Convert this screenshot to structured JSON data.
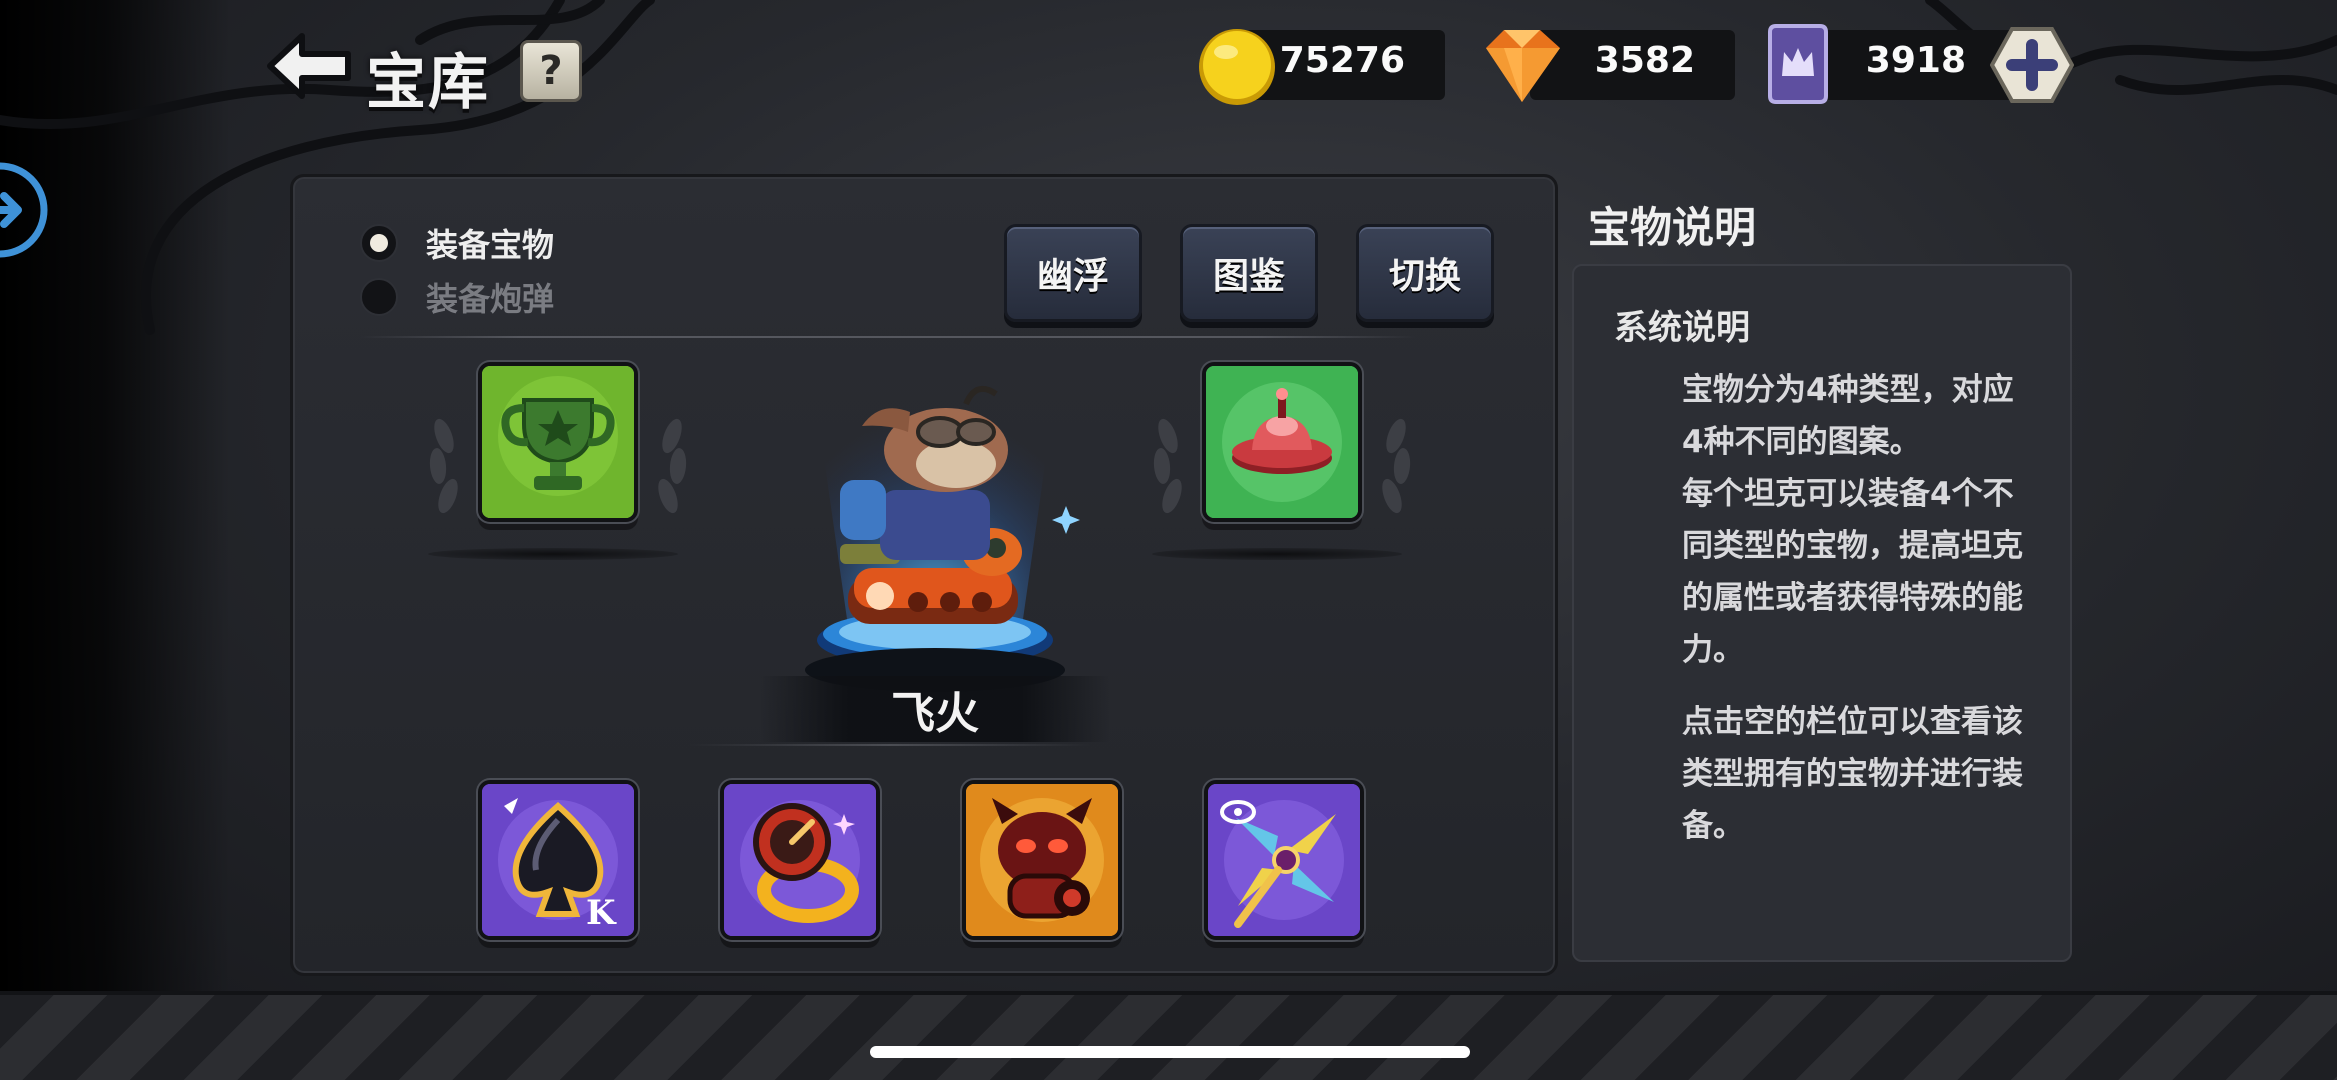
{
  "header": {
    "title": "宝库",
    "help_label": "?"
  },
  "currencies": [
    {
      "icon": "gold-coin-icon",
      "value": "75276"
    },
    {
      "icon": "orange-gem-icon",
      "value": "3582"
    },
    {
      "icon": "purple-crown-token-icon",
      "value": "3918"
    }
  ],
  "equip_options": [
    {
      "label": "装备宝物",
      "selected": true
    },
    {
      "label": "装备炮弹",
      "selected": false
    }
  ],
  "actions": {
    "float_label": "幽浮",
    "codex_label": "图鉴",
    "switch_label": "切换"
  },
  "tank": {
    "name": "飞火"
  },
  "treasure_slots": [
    {
      "icon": "trophy-icon",
      "bg": "#6fb52d"
    },
    {
      "icon": "ufo-icon",
      "bg": "#3fb353"
    },
    {
      "icon": "spade-card-icon",
      "bg": "#6a46c8"
    },
    {
      "icon": "ring-icon",
      "bg": "#6a46c8"
    },
    {
      "icon": "demon-cannon-icon",
      "bg": "#e08a1c"
    },
    {
      "icon": "pinwheel-icon",
      "bg": "#6a46c8"
    }
  ],
  "info": {
    "title": "宝物说明",
    "subtitle": "系统说明",
    "paragraphs": [
      "宝物分为4种类型，对应4种不同的图案。",
      "每个坦克可以装备4个不同类型的宝物，提高坦克的属性或者获得特殊的能力。",
      "点击空的栏位可以查看该类型拥有的宝物并进行装备。"
    ]
  },
  "colors": {
    "accent_blue": "#3f92d8",
    "panel": "#2b2d33",
    "button": "#323a4e"
  }
}
